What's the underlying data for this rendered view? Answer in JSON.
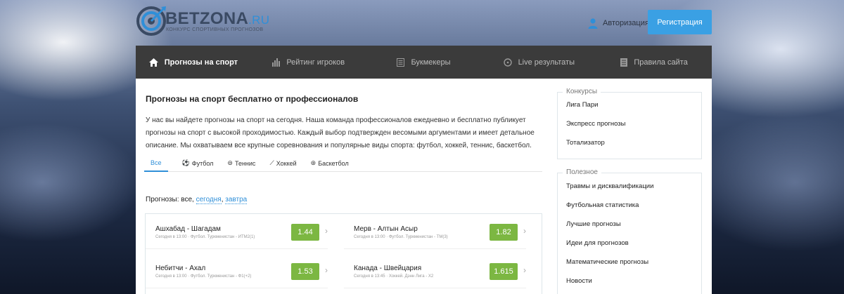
{
  "brand": {
    "name": "BETZONA",
    "tld": ".RU",
    "tagline": "Конкурс спортивных прогнозов"
  },
  "header": {
    "auth_label": "Авторизация",
    "register_label": "Регистрация"
  },
  "nav": {
    "items": [
      {
        "label": "Прогнозы на спорт",
        "icon": "home-icon",
        "active": true
      },
      {
        "label": "Рейтинг игроков",
        "icon": "bar-chart-icon",
        "active": false
      },
      {
        "label": "Букмекеры",
        "icon": "list-icon",
        "active": false
      },
      {
        "label": "Live результаты",
        "icon": "clock-icon",
        "active": false
      },
      {
        "label": "Правила сайта",
        "icon": "document-icon",
        "active": false
      }
    ]
  },
  "main": {
    "title": "Прогнозы на спорт бесплатно от профессионалов",
    "description": "У нас вы найдете прогнозы на спорт на сегодня. Наша команда профессионалов ежедневно и бесплатно публикует прогнозы на спорт с высокой проходимостью. Каждый выбор подтвержден весомыми аргументами и имеет детальное описание. Мы охватываем все крупные соревнования и популярные виды спорта: футбол, хоккей, теннис, баскетбол.",
    "tabs": [
      {
        "label": "Все",
        "icon": ""
      },
      {
        "label": "Футбол",
        "icon": "⚽"
      },
      {
        "label": "Теннис",
        "icon": "⊜"
      },
      {
        "label": "Хоккей",
        "icon": "⟋"
      },
      {
        "label": "Баскетбол",
        "icon": "⊛"
      }
    ],
    "filter": {
      "prefix": "Прогнозы: все,",
      "today": "сегодня",
      "tomorrow": "завтра"
    },
    "matches": [
      {
        "name": "Ашхабад - Шагадам",
        "meta": "Сегодня в 13:00 · Футбол. Туркменистан - ИТМ2(1)",
        "odds": "1.44"
      },
      {
        "name": "Мерв - Алтын Асыр",
        "meta": "Сегодня в 13:00 · Футбол. Туркменистан - ТМ(3)",
        "odds": "1.82"
      },
      {
        "name": "Небитчи - Ахал",
        "meta": "Сегодня в 13:00 · Футбол. Туркменистан - Ф1(+2)",
        "odds": "1.53"
      },
      {
        "name": "Канада - Швейцария",
        "meta": "Сегодня в 13:45 · Хоккей. Дэнн Лига - Х2",
        "odds": "1.615"
      }
    ]
  },
  "sidebar": {
    "contests": {
      "title": "Конкурсы",
      "items": [
        "Лига Пари",
        "Экспресс прогнозы",
        "Тотализатор"
      ]
    },
    "useful": {
      "title": "Полезное",
      "items": [
        "Травмы и дисквалификации",
        "Футбольная статистика",
        "Лучшие прогнозы",
        "Идеи для прогнозов",
        "Математические прогнозы",
        "Новости"
      ]
    }
  },
  "colors": {
    "accent": "#2f8fd8",
    "odds_bg": "#7cb742",
    "nav_bg": "#3b3b3b",
    "register_bg": "#3aa0e4"
  }
}
